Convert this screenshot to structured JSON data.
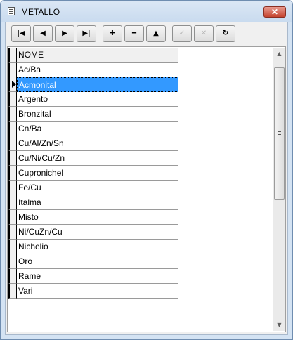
{
  "window": {
    "title": "METALLO",
    "close_label": "✕"
  },
  "toolbar": {
    "buttons": [
      {
        "name": "first-record-button",
        "glyph": "|◀",
        "enabled": true
      },
      {
        "name": "prev-record-button",
        "glyph": "◀",
        "enabled": true
      },
      {
        "name": "next-record-button",
        "glyph": "▶",
        "enabled": true
      },
      {
        "name": "last-record-button",
        "glyph": "▶|",
        "enabled": true
      },
      {
        "name": "insert-record-button",
        "glyph": "✚",
        "enabled": true
      },
      {
        "name": "delete-record-button",
        "glyph": "━",
        "enabled": true
      },
      {
        "name": "edit-record-button",
        "glyph": "▲",
        "enabled": true
      },
      {
        "name": "post-record-button",
        "glyph": "✓",
        "enabled": false
      },
      {
        "name": "cancel-record-button",
        "glyph": "✕",
        "enabled": false
      },
      {
        "name": "refresh-button",
        "glyph": "↻",
        "enabled": true
      }
    ]
  },
  "grid": {
    "header": "NOME",
    "rows": [
      "Ac/Ba",
      "Acmonital",
      "Argento",
      "Bronzital",
      "Cn/Ba",
      "Cu/Al/Zn/Sn",
      "Cu/Ni/Cu/Zn",
      "Cupronichel",
      "Fe/Cu",
      "Italma",
      "Misto",
      "Ni/CuZn/Cu",
      "Nichelio",
      "Oro",
      "Rame",
      "Vari"
    ],
    "selected_index": 1
  },
  "scrollbar": {
    "up_glyph": "▲",
    "down_glyph": "▼"
  },
  "colors": {
    "selection": "#3399ff",
    "title_bar": "#c9dbef"
  }
}
